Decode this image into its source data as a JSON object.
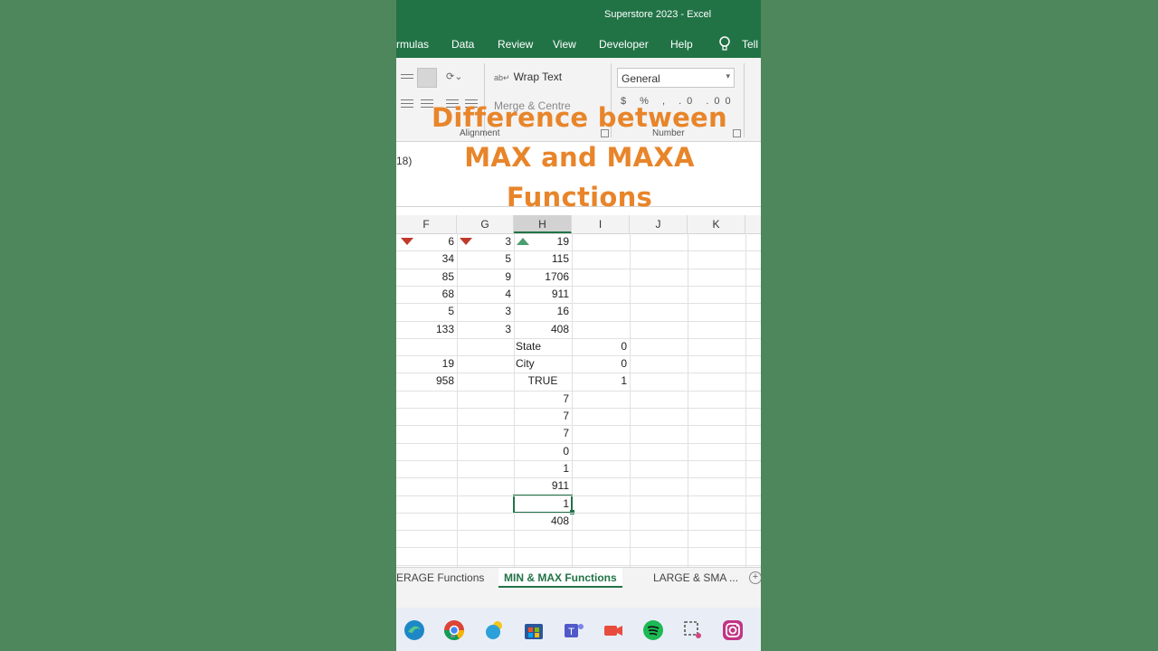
{
  "window": {
    "title": "Superstore 2023  -  Excel"
  },
  "ribbon_tabs": [
    "rmulas",
    "Data",
    "Review",
    "View",
    "Developer",
    "Help",
    "Tell"
  ],
  "ribbon": {
    "wrap_text": "Wrap Text",
    "merge_centre": "Merge & Centre",
    "number_format": "General",
    "alignment_label": "Alignment",
    "number_label": "Number"
  },
  "formula_fragment": "18)",
  "caption": {
    "line1": "Difference between",
    "line2": "MAX and MAXA",
    "line3": "Functions"
  },
  "columns": [
    "F",
    "G",
    "H",
    "I",
    "J",
    "K"
  ],
  "active_column": "H",
  "rows": [
    {
      "F": "6",
      "G": "3",
      "H": "19",
      "I": ""
    },
    {
      "F": "34",
      "G": "5",
      "H": "115",
      "I": ""
    },
    {
      "F": "85",
      "G": "9",
      "H": "1706",
      "I": ""
    },
    {
      "F": "68",
      "G": "4",
      "H": "911",
      "I": ""
    },
    {
      "F": "5",
      "G": "3",
      "H": "16",
      "I": ""
    },
    {
      "F": "133",
      "G": "3",
      "H": "408",
      "I": ""
    },
    {
      "F": "",
      "G": "",
      "H": "State",
      "I": "0"
    },
    {
      "F": "19",
      "G": "",
      "H": "City",
      "I": "0"
    },
    {
      "F": "958",
      "G": "",
      "H": "TRUE",
      "I": "1"
    },
    {
      "F": "",
      "G": "",
      "H": "7",
      "I": ""
    },
    {
      "F": "",
      "G": "",
      "H": "7",
      "I": ""
    },
    {
      "F": "",
      "G": "",
      "H": "7",
      "I": ""
    },
    {
      "F": "",
      "G": "",
      "H": "0",
      "I": ""
    },
    {
      "F": "",
      "G": "",
      "H": "1",
      "I": ""
    },
    {
      "F": "",
      "G": "",
      "H": "911",
      "I": ""
    },
    {
      "F": "",
      "G": "",
      "H": "1",
      "I": ""
    },
    {
      "F": "",
      "G": "",
      "H": "408",
      "I": ""
    }
  ],
  "sheet_tabs": [
    "ERAGE Functions",
    "MIN & MAX Functions",
    "LARGE & SMA ..."
  ],
  "active_sheet": "MIN & MAX Functions",
  "taskbar_icons": [
    "edge-icon",
    "chrome-icon",
    "weather-icon",
    "store-icon",
    "teams-icon",
    "camera-icon",
    "spotify-icon",
    "snipping-tool-icon",
    "instagram-icon"
  ],
  "colors": {
    "excel_green": "#217346",
    "background": "#4f875c",
    "caption": "#e8852a"
  }
}
